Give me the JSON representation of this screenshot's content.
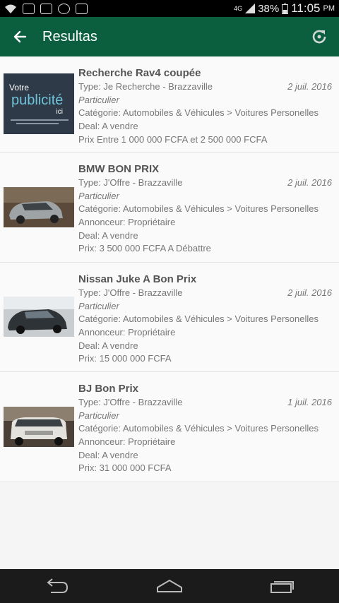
{
  "status_bar": {
    "network": "4G",
    "battery": "38%",
    "time": "11:05",
    "ampm": "PM"
  },
  "app_bar": {
    "title": "Resultas",
    "back_icon": "arrow-left-icon",
    "refresh_icon": "refresh-icon"
  },
  "ad": {
    "line1": "Votre",
    "line2": "publicité",
    "line3": "ici"
  },
  "items": [
    {
      "title": "Recherche Rav4 coupée",
      "type": "Type: Je Recherche - Brazzaville",
      "date": "2 juil. 2016",
      "seller": "Particulier",
      "category": "Catégorie: Automobiles & Véhicules > Voitures Personelles",
      "deal": "Deal: A vendre",
      "price": "Prix Entre 1 000 000 FCFA et 2 500 000 FCFA"
    },
    {
      "title": "BMW BON PRIX",
      "type": "Type: J'Offre - Brazzaville",
      "date": "2 juil. 2016",
      "seller": "Particulier",
      "category": "Catégorie: Automobiles & Véhicules > Voitures Personelles",
      "advertiser": "Annonceur: Propriétaire",
      "deal": "Deal: A vendre",
      "price": "Prix: 3 500 000 FCFA A Débattre"
    },
    {
      "title": "Nissan Juke A Bon Prix",
      "type": "Type: J'Offre - Brazzaville",
      "date": "2 juil. 2016",
      "seller": "Particulier",
      "category": "Catégorie: Automobiles & Véhicules > Voitures Personelles",
      "advertiser": "Annonceur: Propriétaire",
      "deal": "Deal: A vendre",
      "price": "Prix: 15 000 000 FCFA"
    },
    {
      "title": "BJ Bon Prix",
      "type": "Type: J'Offre - Brazzaville",
      "date": "1 juil. 2016",
      "seller": "Particulier",
      "category": "Catégorie: Automobiles & Véhicules > Voitures Personelles",
      "advertiser": "Annonceur: Propriétaire",
      "deal": "Deal: A vendre",
      "price": "Prix: 31 000 000 FCFA"
    }
  ],
  "nav_bar": {
    "back_icon": "nav-back-icon",
    "home_icon": "nav-home-icon",
    "recents_icon": "nav-recents-icon"
  },
  "colors": {
    "app_bar": "#0b5e3e",
    "status_bar": "#000000",
    "nav_bar": "#1b1b1b"
  }
}
